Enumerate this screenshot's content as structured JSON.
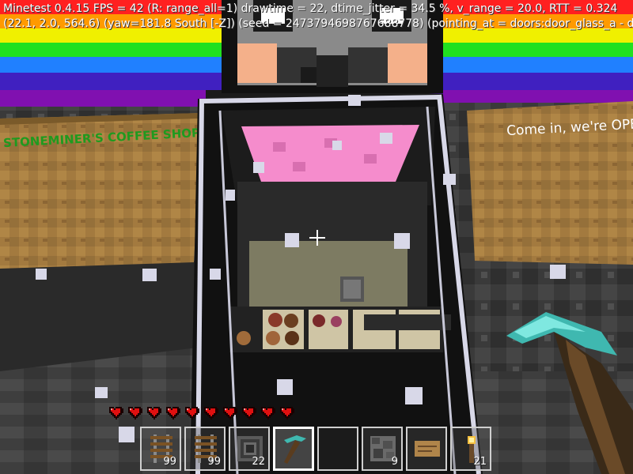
{
  "debug": {
    "line1": "Minetest 0.4.15 FPS = 42 (R: range_all=1) drawtime = 22, dtime_jitter = 34.5 %, v_range = 20.0, RTT = 0.324",
    "line2": "(22.1, 2.0, 564.6) (yaw=181.8 South [-Z]) (seed = 2473794698767688778) (pointing_at = doors:door_glass_a - doors"
  },
  "signs": {
    "left": "STONEMINER'S COFFEE SHOP",
    "right": "Come in, we're OPEN"
  },
  "colors": {
    "sign_left_text": "#1f9a1f",
    "sign_right_text": "#ffffff",
    "heart": "#e01010"
  },
  "hud": {
    "health_hearts": 10,
    "hotbar": [
      {
        "item": "rail-icon",
        "count": "99",
        "selected": false
      },
      {
        "item": "rail-icon",
        "count": "99",
        "selected": false
      },
      {
        "item": "furnace-icon",
        "count": "22",
        "selected": false
      },
      {
        "item": "diamond-pickaxe-icon",
        "count": "",
        "selected": true
      },
      {
        "item": "empty-slot",
        "count": "",
        "selected": false
      },
      {
        "item": "cobblestone-icon",
        "count": "9",
        "selected": false
      },
      {
        "item": "sign-icon",
        "count": "",
        "selected": false
      },
      {
        "item": "torch-icon",
        "count": "21",
        "selected": false
      }
    ]
  }
}
